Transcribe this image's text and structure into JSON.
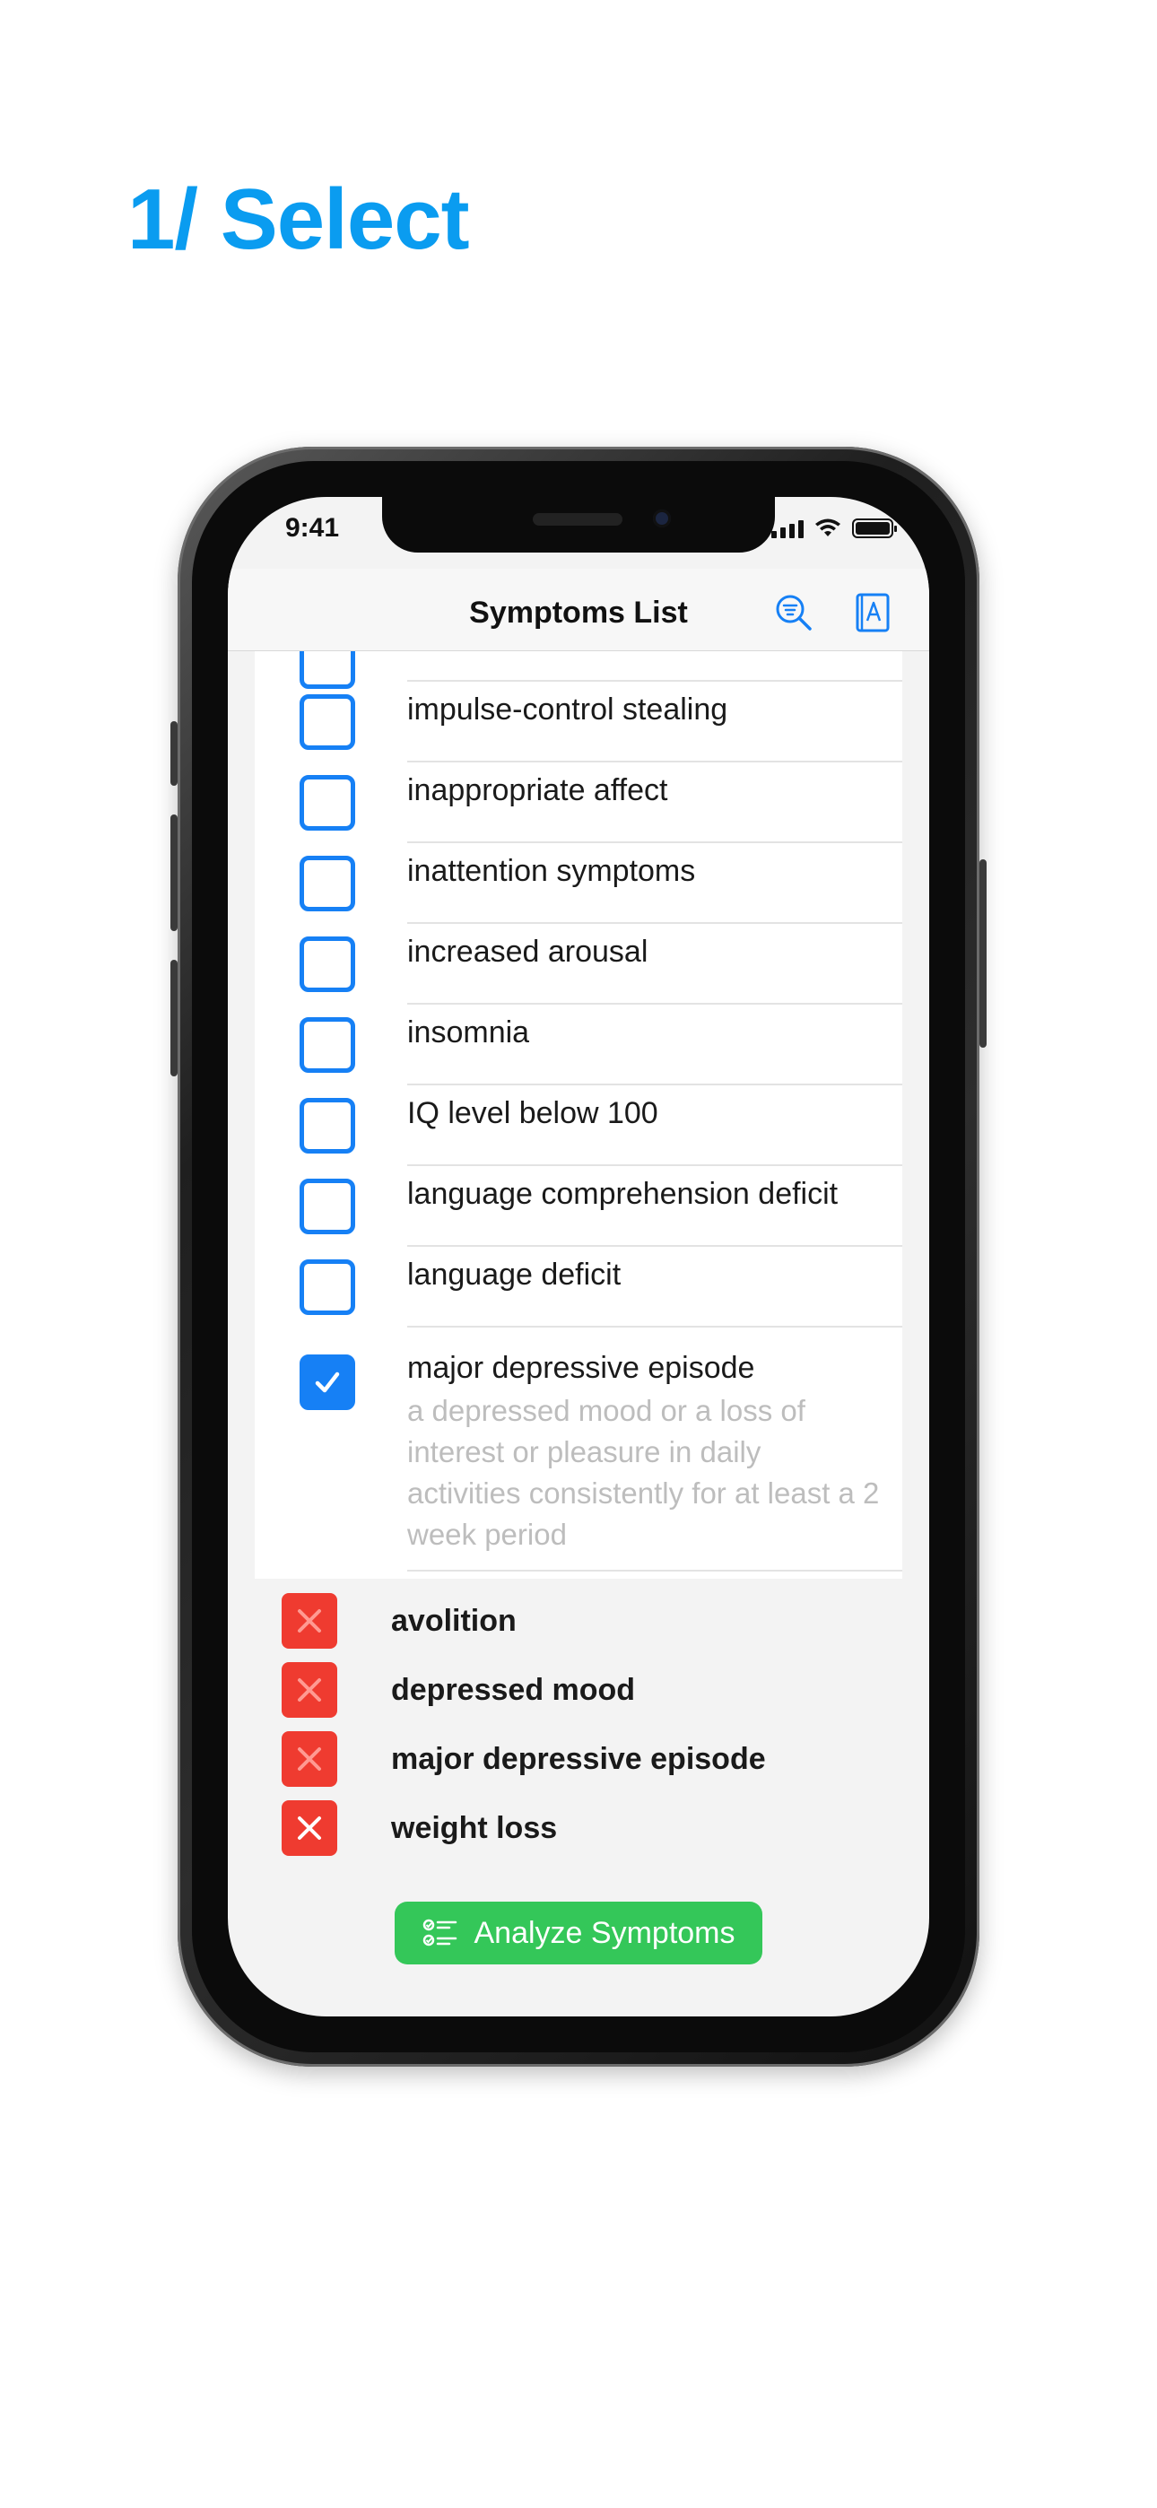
{
  "headline": "1/ Select",
  "status": {
    "time": "9:41"
  },
  "nav": {
    "title": "Symptoms List",
    "search_icon": "search-list-icon",
    "dictionary_icon": "dictionary-book-icon"
  },
  "list": {
    "items": [
      {
        "label": "impulse-control stealing",
        "checked": false
      },
      {
        "label": "inappropriate affect",
        "checked": false
      },
      {
        "label": "inattention symptoms",
        "checked": false
      },
      {
        "label": "increased arousal",
        "checked": false
      },
      {
        "label": "insomnia",
        "checked": false
      },
      {
        "label": "IQ level below 100",
        "checked": false
      },
      {
        "label": "language comprehension deficit",
        "checked": false
      },
      {
        "label": "language deficit",
        "checked": false
      },
      {
        "label": "major depressive episode",
        "checked": true,
        "description": "a depressed mood or a loss of interest or pleasure in daily activities consistently for at least a 2 week period"
      }
    ]
  },
  "selected": {
    "items": [
      {
        "label": "avolition"
      },
      {
        "label": "depressed mood"
      },
      {
        "label": "major depressive episode"
      },
      {
        "label": "weight loss"
      }
    ]
  },
  "actions": {
    "analyze_label": "Analyze Symptoms"
  },
  "colors": {
    "accent_blue": "#1680f5",
    "headline_blue": "#0a9cf0",
    "remove_red": "#ef3b30",
    "analyze_green": "#34c759"
  }
}
